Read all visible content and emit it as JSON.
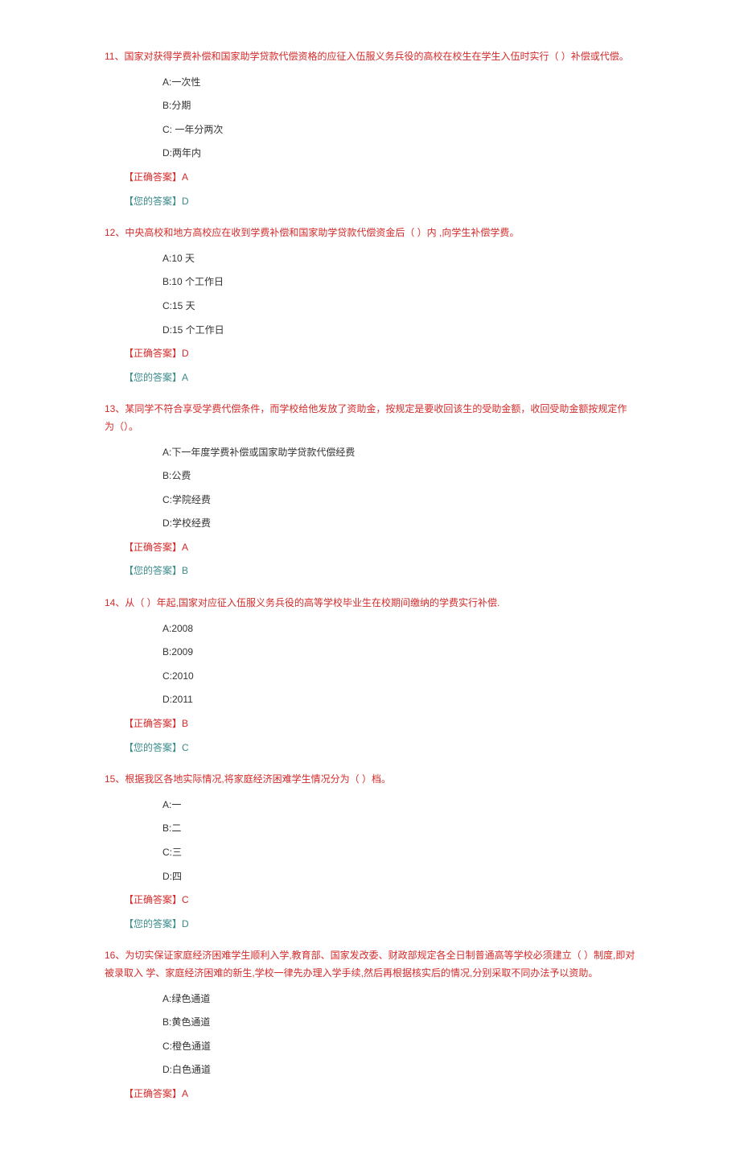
{
  "labels": {
    "correct_prefix": "【正确答案】",
    "your_prefix": "【您的答案】"
  },
  "questions": [
    {
      "num": "11",
      "text": "11、国家对获得学费补偿和国家助学贷款代偿资格的应征入伍服义务兵役的高校在校生在学生入伍时实行（ ）补偿或代偿。",
      "options": [
        "A:一次性",
        "B:分期",
        "C: 一年分两次",
        "D:两年内"
      ],
      "correct": "A",
      "yours": "D"
    },
    {
      "num": "12",
      "text": "12、中央高校和地方高校应在收到学费补偿和国家助学贷款代偿资金后（  ）内 ,向学生补偿学费。",
      "options": [
        "A:10 天",
        "B:10 个工作日",
        "C:15 天",
        "D:15 个工作日"
      ],
      "correct": "D",
      "yours": "A"
    },
    {
      "num": "13",
      "text": "13、某同学不符合享受学费代偿条件，而学校给他发放了资助金，按规定是要收回该生的受助金额，收回受助金额按规定作为（）。",
      "options": [
        "A:下一年度学费补偿或国家助学贷款代偿经费",
        "B:公费",
        "C:学院经费",
        "D:学校经费"
      ],
      "correct": "A",
      "yours": "B"
    },
    {
      "num": "14",
      "text": "14、从（  ）年起,国家对应征入伍服义务兵役的高等学校毕业生在校期间缴纳的学费实行补偿.",
      "options": [
        "A:2008",
        "B:2009",
        "C:2010",
        "D:2011"
      ],
      "correct": "B",
      "yours": "C"
    },
    {
      "num": "15",
      "text": "15、根据我区各地实际情况,将家庭经济困难学生情况分为（  ）档。",
      "options": [
        "A:一",
        "B:二",
        "C:三",
        "D:四"
      ],
      "correct": "C",
      "yours": "D"
    },
    {
      "num": "16",
      "text": "16、为切实保证家庭经济困难学生顺利入学,教育部、国家发改委、财政部规定各全日制普通高等学校必须建立（  ）制度,即对被录取入 学、家庭经济困难的新生,学校一律先办理入学手续,然后再根据核实后的情况,分别采取不同办法予以资助。",
      "options": [
        "A:绿色通道",
        "B:黄色通道",
        "C:橙色通道",
        "D:白色通道"
      ],
      "correct": "A",
      "yours": null
    }
  ]
}
